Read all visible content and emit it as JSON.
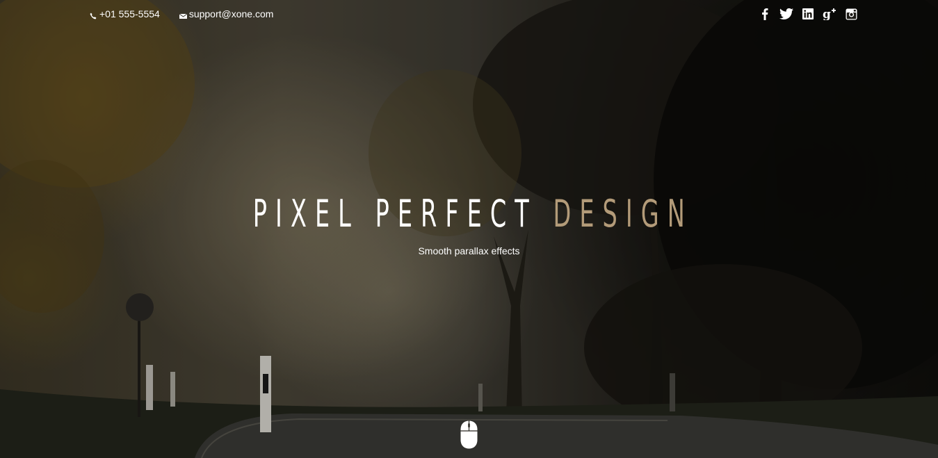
{
  "topbar": {
    "phone": "+01 555-5554",
    "email": "support@xone.com",
    "social": [
      {
        "name": "facebook-icon",
        "glyph": "f"
      },
      {
        "name": "twitter-icon",
        "glyph": "t"
      },
      {
        "name": "linkedin-icon",
        "glyph": "in"
      },
      {
        "name": "google-plus-icon",
        "glyph": "g+"
      },
      {
        "name": "instagram-icon",
        "glyph": "ig"
      }
    ]
  },
  "hero": {
    "title_main": "PIXEL PERFECT",
    "title_accent": "DESIGN",
    "subtitle": "Smooth parallax effects",
    "accent_color": "#b39b79"
  },
  "icons": {
    "phone": "phone-icon",
    "email": "envelope-icon",
    "scroll": "mouse-scroll-icon"
  }
}
